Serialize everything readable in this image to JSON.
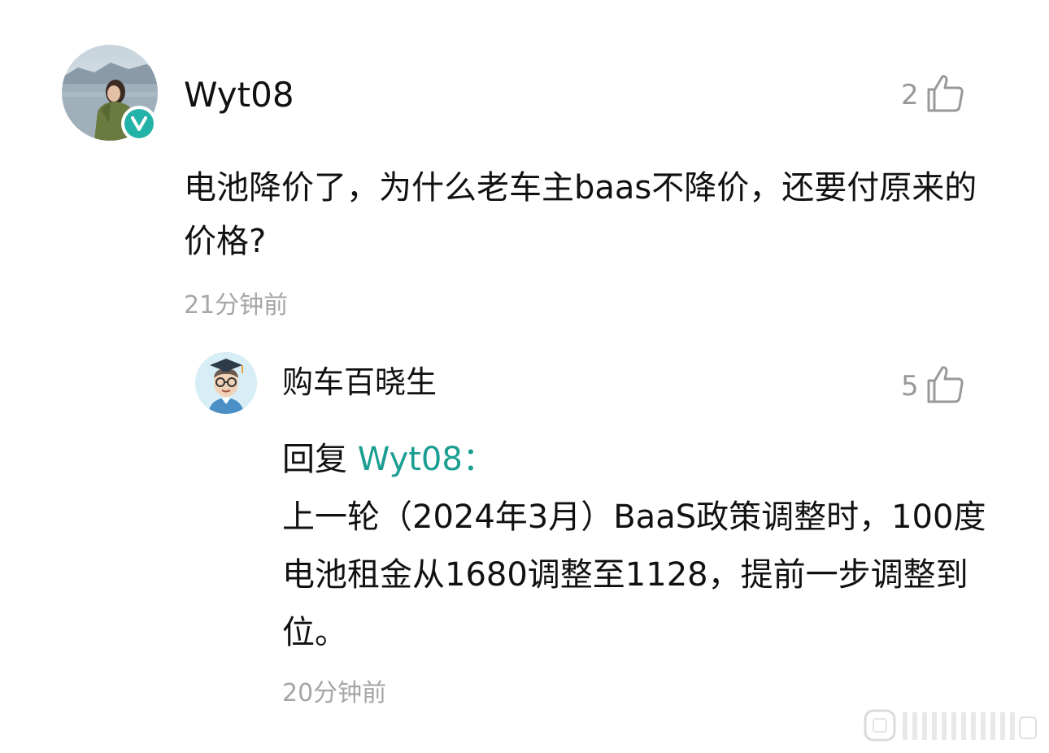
{
  "comment": {
    "username": "Wyt08",
    "like_count": "2",
    "text": "电池降价了，为什么老车主baas不降价，还要付原来的价格?",
    "time": "21分钟前"
  },
  "reply": {
    "username": "购车百晓生",
    "like_count": "5",
    "reply_prefix": "回复 ",
    "mention": "Wyt08",
    "mention_colon": "：",
    "text": "上一轮（2024年3月）BaaS政策调整时，100度电池租金从1680调整至1128，提前一步调整到位。",
    "time": "20分钟前"
  },
  "icons": {
    "like": "thumbs-up-icon",
    "verified": "verified-v-icon"
  },
  "colors": {
    "accent": "#22b2a8",
    "mention": "#1b9e92",
    "muted": "#a6a6a6"
  }
}
